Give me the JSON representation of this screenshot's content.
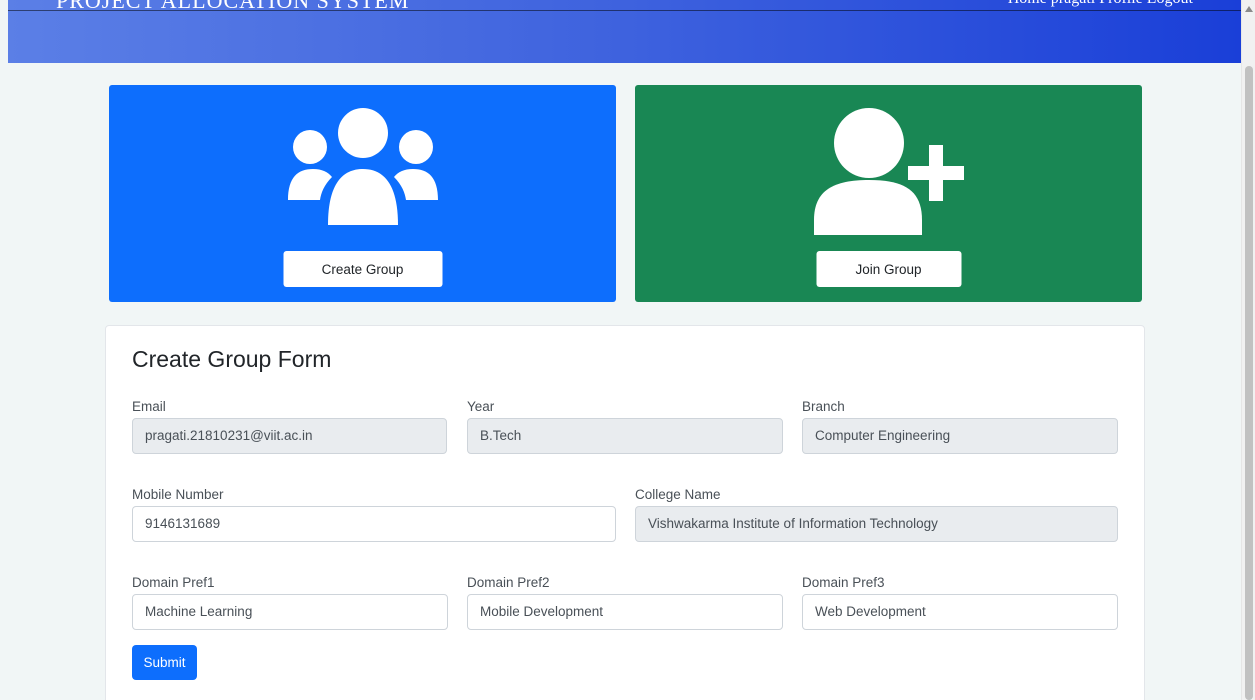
{
  "header": {
    "brand": "PROJECT ALLOCATION SYSTEM",
    "nav_text": "Home  pragati  Profile  Logout"
  },
  "tiles": {
    "create": {
      "button_label": "Create Group",
      "icon": "users-group-icon",
      "color": "#0d6efd"
    },
    "join": {
      "button_label": "Join Group",
      "icon": "user-plus-icon",
      "color": "#198754"
    }
  },
  "form": {
    "title": "Create Group Form",
    "email": {
      "label": "Email",
      "value": "pragati.21810231@viit.ac.in"
    },
    "year": {
      "label": "Year",
      "value": "B.Tech"
    },
    "branch": {
      "label": "Branch",
      "value": "Computer Engineering"
    },
    "mobile": {
      "label": "Mobile Number",
      "value": "9146131689"
    },
    "college": {
      "label": "College Name",
      "value": "Vishwakarma Institute of Information Technology"
    },
    "domain1": {
      "label": "Domain Pref1",
      "value": "Machine Learning"
    },
    "domain2": {
      "label": "Domain Pref2",
      "value": "Mobile Development"
    },
    "domain3": {
      "label": "Domain Pref3",
      "value": "Web Development"
    },
    "submit_label": "Submit"
  }
}
